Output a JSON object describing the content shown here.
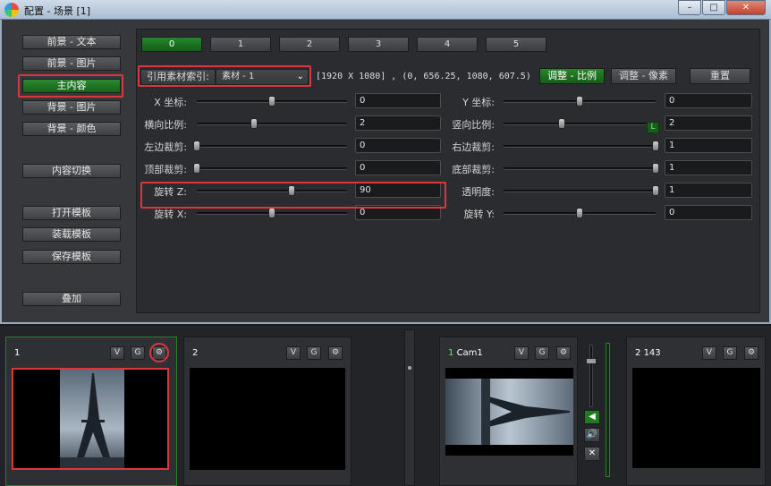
{
  "window": {
    "title": "配置 - 场景 [1]",
    "minimize": "–",
    "maximize": "□",
    "close": "✕"
  },
  "left_buttons": {
    "front_text": "前景 - 文本",
    "front_image": "前景 - 图片",
    "main_content": "主内容",
    "back_image": "背景 - 图片",
    "back_color": "背景 - 颜色",
    "content_switch": "内容切换",
    "open_template": "打开模板",
    "load_template": "装载模板",
    "save_template": "保存模板",
    "overlay": "叠加"
  },
  "tabs": [
    "0",
    "1",
    "2",
    "3",
    "4",
    "5"
  ],
  "reference": {
    "label": "引用素材索引:",
    "value": "素材 - 1",
    "resolution": "[1920 X 1080] , (0, 656.25, 1080, 607.5)"
  },
  "actions": {
    "adjust_ratio": "调整 - 比例",
    "adjust_pixel": "调整 - 像素",
    "reset": "重置"
  },
  "params_left": [
    {
      "label": "X 坐标:",
      "value": "0",
      "level": 0.5
    },
    {
      "label": "横向比例:",
      "value": "2",
      "level": 0.38
    },
    {
      "label": "左边裁剪:",
      "value": "0",
      "level": 0.0
    },
    {
      "label": "顶部裁剪:",
      "value": "0",
      "level": 0.0
    },
    {
      "label": "旋转 Z:",
      "value": "90",
      "level": 0.63
    },
    {
      "label": "旋转 X:",
      "value": "0",
      "level": 0.5
    }
  ],
  "params_right": [
    {
      "label": "Y 坐标:",
      "value": "0",
      "level": 0.5
    },
    {
      "label": "竖向比例:",
      "value": "2",
      "level": 0.38
    },
    {
      "label": "右边裁剪:",
      "value": "1",
      "level": 1.0
    },
    {
      "label": "底部裁剪:",
      "value": "1",
      "level": 1.0
    },
    {
      "label": "透明度:",
      "value": "1",
      "level": 1.0
    },
    {
      "label": "旋转 Y:",
      "value": "0",
      "level": 0.5
    }
  ],
  "lock_label": "L",
  "cells": [
    {
      "num": "1",
      "name": ""
    },
    {
      "num": "2",
      "name": ""
    },
    {
      "num": "1",
      "name": "Cam1"
    },
    {
      "num": "2",
      "name": "143"
    }
  ],
  "cell_buttons": {
    "v": "V",
    "g": "G",
    "gear": "⚙"
  },
  "audio": {
    "speaker": "◀",
    "volume": "🔊",
    "mute": "✕"
  },
  "colors": {
    "accent_green": "#1f7a22",
    "highlight_red": "#d9363e"
  }
}
